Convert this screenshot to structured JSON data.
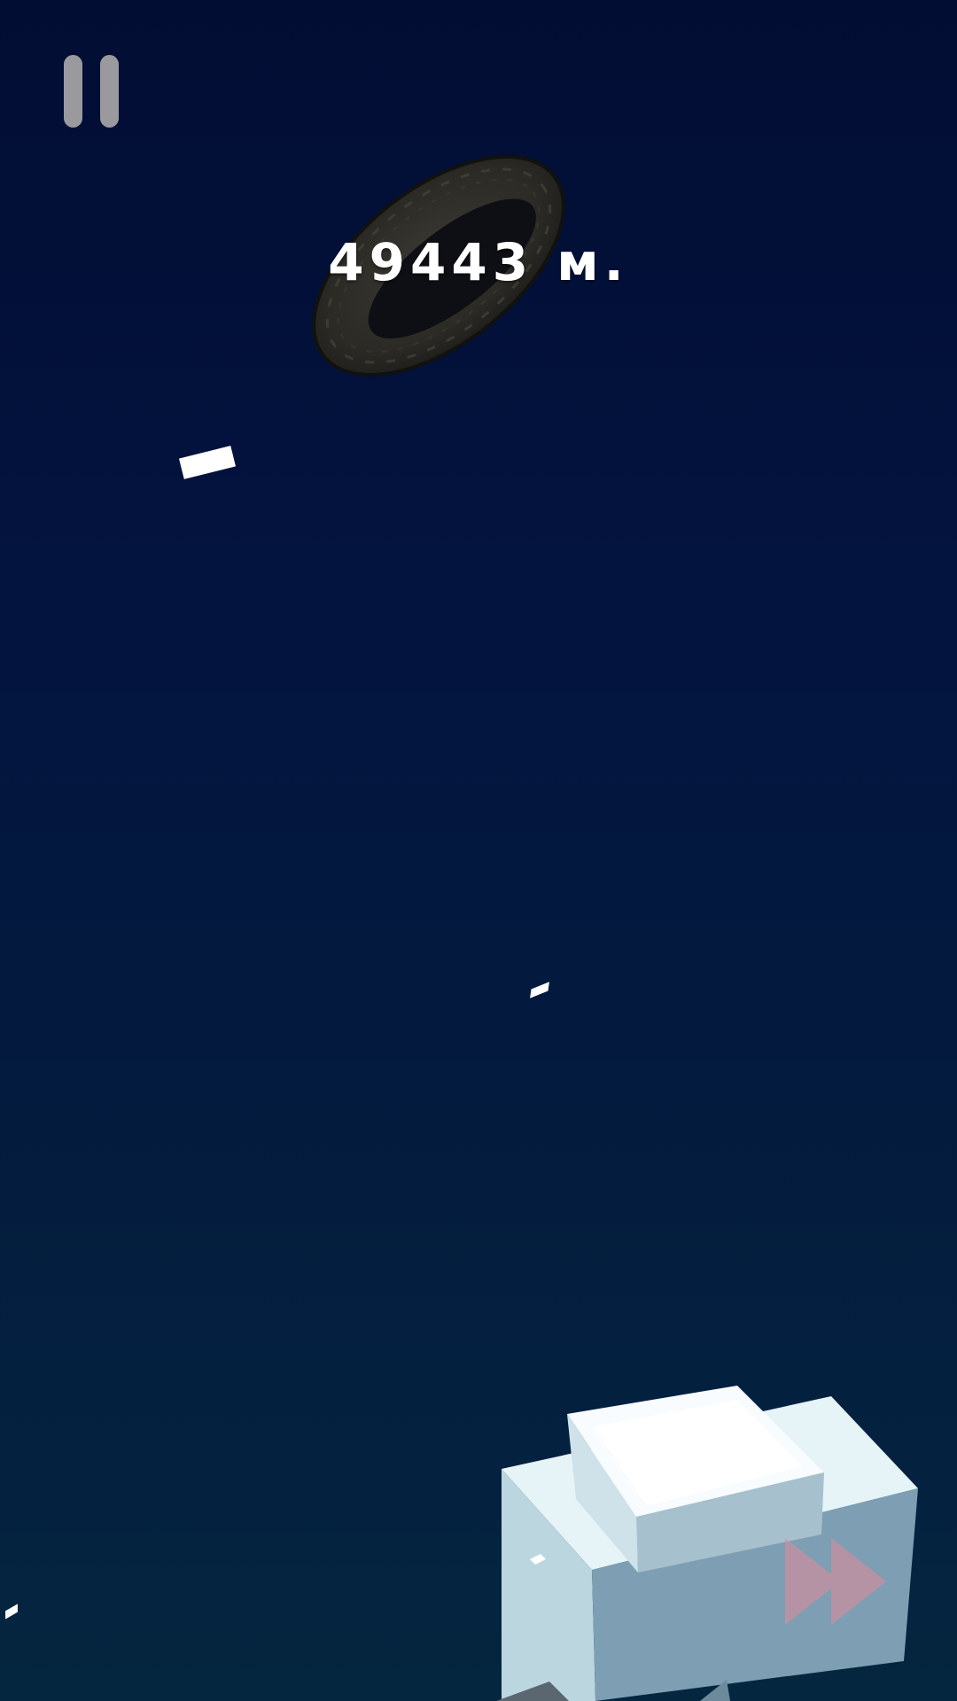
{
  "hud": {
    "distance_label": "49443 м."
  },
  "icons": {
    "pause": "pause-icon",
    "fast_forward": "fast-forward-icon"
  },
  "colors": {
    "background_top": "#020d33",
    "background_bottom": "#05263f",
    "pause_button": "#9a9a9e",
    "distance_text": "#ffffff",
    "fast_forward": "#e28a9a",
    "ice": "#e8f4f8"
  }
}
